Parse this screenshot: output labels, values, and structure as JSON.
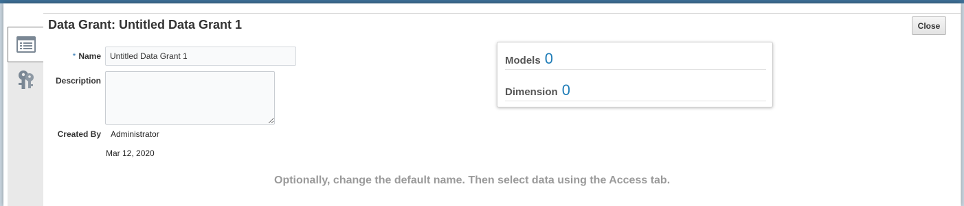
{
  "dialog": {
    "title": "Data Grant: Untitled Data Grant 1",
    "close_label": "Close"
  },
  "rail": {
    "tabs": [
      {
        "icon": "list-icon",
        "active": true
      },
      {
        "icon": "keys-icon",
        "active": false
      }
    ]
  },
  "form": {
    "required_marker": "*",
    "name_label": "Name",
    "name_value": "Untitled Data Grant 1",
    "description_label": "Description",
    "description_value": "",
    "created_by_label": "Created By",
    "created_by_value": "Administrator",
    "created_date": "Mar 12, 2020"
  },
  "summary": {
    "models_label": "Models",
    "models_count": "0",
    "dimension_label": "Dimension",
    "dimension_count": "0"
  },
  "hint": "Optionally, change the default name. Then select data using the Access tab.",
  "colors": {
    "accent": "#1f7db8",
    "required": "#3279b3",
    "hint": "#9a9a9a"
  }
}
